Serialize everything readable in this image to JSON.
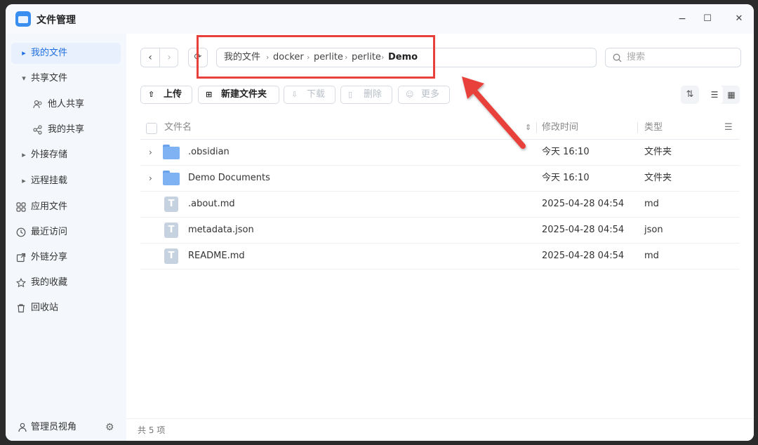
{
  "app": {
    "title": "文件管理"
  },
  "window_controls": {
    "minimize": "−",
    "maximize": "☐",
    "close": "✕"
  },
  "sidebar": {
    "items": [
      {
        "label": "我的文件",
        "icon": "▸"
      },
      {
        "label": "共享文件",
        "icon": "▾"
      },
      {
        "label": "他人共享",
        "icon": "people-icon"
      },
      {
        "label": "我的共享",
        "icon": "share-icon"
      },
      {
        "label": "外接存储",
        "icon": "▸"
      },
      {
        "label": "远程挂载",
        "icon": "▸"
      },
      {
        "label": "应用文件",
        "icon": "grid-icon"
      },
      {
        "label": "最近访问",
        "icon": "clock-icon"
      },
      {
        "label": "外链分享",
        "icon": "link-share-icon"
      },
      {
        "label": "我的收藏",
        "icon": "star-icon"
      },
      {
        "label": "回收站",
        "icon": "trash-icon"
      }
    ],
    "footer": {
      "label": "管理员视角"
    }
  },
  "breadcrumb": [
    "我的文件",
    "docker",
    "perlite",
    "perlite",
    "Demo"
  ],
  "search": {
    "placeholder": "搜索"
  },
  "toolbar": {
    "upload": "上传",
    "new_folder": "新建文件夹",
    "download": "下载",
    "delete": "删除",
    "more": "更多"
  },
  "table": {
    "headers": {
      "name": "文件名",
      "modified": "修改时间",
      "type": "类型"
    },
    "rows": [
      {
        "name": ".obsidian",
        "modified": "今天 16:10",
        "type": "文件夹",
        "kind": "folder"
      },
      {
        "name": "Demo Documents",
        "modified": "今天 16:10",
        "type": "文件夹",
        "kind": "folder"
      },
      {
        "name": ".about.md",
        "modified": "2025-04-28 04:54",
        "type": "md",
        "kind": "file"
      },
      {
        "name": "metadata.json",
        "modified": "2025-04-28 04:54",
        "type": "json",
        "kind": "file"
      },
      {
        "name": "README.md",
        "modified": "2025-04-28 04:54",
        "type": "md",
        "kind": "file"
      }
    ]
  },
  "status": {
    "count_text": "共 5 项"
  },
  "colors": {
    "accent": "#1f6fe0",
    "annotation": "#e8413b"
  }
}
